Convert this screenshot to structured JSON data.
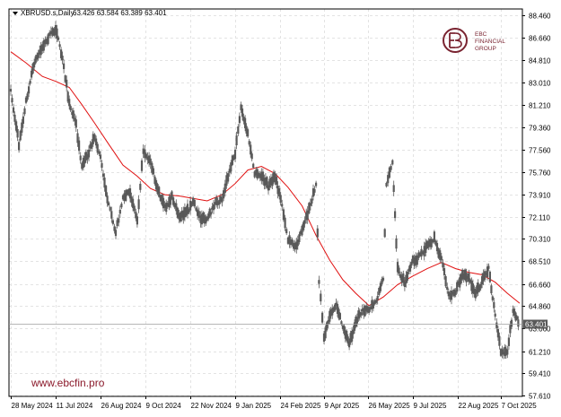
{
  "header": {
    "dropdown_icon": "triangle-down-icon",
    "symbol": "XBRUSD.s,Daily",
    "ohlc": "63.426 63.584 63.389 63.401"
  },
  "logo": {
    "icon": "ebc-monogram-icon",
    "line1": "EBC",
    "line2": "FINANCIAL",
    "line3": "GROUP",
    "color": "#7a2431"
  },
  "watermark": {
    "text": "www.ebcfin.pro",
    "color": "#8b1a2b"
  },
  "current_price": {
    "label": "63.401",
    "value": 63.401
  },
  "chart_data": {
    "type": "line",
    "title": "",
    "symbol": "XBRUSD.s",
    "timeframe": "Daily",
    "candle_color": "#595959",
    "ma_color": "#e01010",
    "grid": true,
    "y_ticks": [
      "88.460",
      "86.660",
      "84.810",
      "83.010",
      "81.210",
      "79.360",
      "77.560",
      "75.760",
      "73.910",
      "72.110",
      "70.310",
      "68.510",
      "66.660",
      "64.860",
      "63.060",
      "61.210",
      "59.410",
      "57.610"
    ],
    "ylim": [
      57.61,
      88.46
    ],
    "x_ticks": [
      "28 May 2024",
      "11 Jul 2024",
      "26 Aug 2024",
      "9 Oct 2024",
      "22 Nov 2024",
      "9 Jan 2025",
      "24 Feb 2025",
      "9 Apr 2025",
      "26 May 2025",
      "9 Jul 2025",
      "22 Aug 2025",
      "7 Oct 2025"
    ],
    "series": [
      {
        "name": "",
        "kind": "price",
        "x": [
          "2024-05-28",
          "2024-06-05",
          "2024-06-12",
          "2024-06-20",
          "2024-06-28",
          "2024-07-05",
          "2024-07-11",
          "2024-07-18",
          "2024-07-25",
          "2024-08-01",
          "2024-08-07",
          "2024-08-14",
          "2024-08-20",
          "2024-08-26",
          "2024-09-03",
          "2024-09-10",
          "2024-09-17",
          "2024-09-24",
          "2024-10-01",
          "2024-10-07",
          "2024-10-14",
          "2024-10-21",
          "2024-10-28",
          "2024-11-04",
          "2024-11-11",
          "2024-11-18",
          "2024-11-25",
          "2024-12-03",
          "2024-12-10",
          "2024-12-17",
          "2024-12-26",
          "2025-01-03",
          "2025-01-09",
          "2025-01-15",
          "2025-01-22",
          "2025-01-29",
          "2025-02-05",
          "2025-02-12",
          "2025-02-19",
          "2025-02-26",
          "2025-03-04",
          "2025-03-11",
          "2025-03-18",
          "2025-03-25",
          "2025-04-01",
          "2025-04-04",
          "2025-04-09",
          "2025-04-15",
          "2025-04-22",
          "2025-04-29",
          "2025-05-06",
          "2025-05-13",
          "2025-05-20",
          "2025-05-27",
          "2025-06-03",
          "2025-06-10",
          "2025-06-13",
          "2025-06-19",
          "2025-06-24",
          "2025-07-01",
          "2025-07-09",
          "2025-07-16",
          "2025-07-23",
          "2025-07-30",
          "2025-08-06",
          "2025-08-13",
          "2025-08-20",
          "2025-08-27",
          "2025-09-03",
          "2025-09-10",
          "2025-09-17",
          "2025-09-24",
          "2025-10-01",
          "2025-10-07",
          "2025-10-14",
          "2025-10-20",
          "2025-10-27"
        ],
        "y": [
          82.3,
          78.0,
          81.5,
          84.6,
          85.9,
          86.8,
          87.4,
          84.9,
          81.3,
          79.5,
          76.2,
          77.4,
          78.6,
          76.9,
          73.0,
          70.9,
          73.6,
          74.1,
          71.9,
          77.5,
          76.6,
          74.3,
          72.8,
          73.7,
          72.2,
          72.4,
          73.3,
          72.0,
          71.8,
          73.0,
          73.6,
          75.9,
          77.3,
          80.9,
          78.8,
          75.6,
          75.4,
          74.6,
          75.3,
          73.1,
          70.2,
          69.7,
          70.9,
          72.7,
          74.7,
          67.0,
          62.3,
          63.9,
          65.1,
          63.1,
          61.9,
          63.6,
          64.6,
          64.5,
          65.3,
          67.1,
          74.8,
          76.4,
          67.9,
          66.7,
          68.5,
          68.9,
          69.8,
          70.3,
          68.6,
          65.8,
          66.0,
          67.4,
          67.1,
          65.9,
          66.8,
          67.9,
          64.1,
          61.1,
          61.3,
          64.4,
          63.4
        ]
      },
      {
        "name": "",
        "kind": "moving-average",
        "x": [
          "2024-05-28",
          "2024-06-12",
          "2024-06-28",
          "2024-07-11",
          "2024-07-25",
          "2024-08-07",
          "2024-08-20",
          "2024-09-03",
          "2024-09-17",
          "2024-10-01",
          "2024-10-14",
          "2024-10-28",
          "2024-11-11",
          "2024-11-25",
          "2024-12-10",
          "2024-12-26",
          "2025-01-09",
          "2025-01-22",
          "2025-02-05",
          "2025-02-19",
          "2025-03-04",
          "2025-03-18",
          "2025-04-01",
          "2025-04-15",
          "2025-04-29",
          "2025-05-13",
          "2025-05-27",
          "2025-06-10",
          "2025-06-24",
          "2025-07-09",
          "2025-07-23",
          "2025-08-06",
          "2025-08-20",
          "2025-09-03",
          "2025-09-17",
          "2025-10-01",
          "2025-10-14",
          "2025-10-27"
        ],
        "y": [
          85.5,
          84.6,
          83.5,
          83.1,
          82.6,
          81.2,
          79.7,
          78.0,
          76.3,
          75.4,
          74.4,
          73.9,
          73.8,
          73.6,
          73.4,
          73.9,
          74.8,
          75.9,
          76.2,
          75.6,
          74.5,
          73.0,
          70.6,
          68.6,
          67.0,
          65.9,
          64.9,
          65.6,
          66.6,
          67.3,
          67.9,
          68.4,
          67.9,
          67.6,
          67.4,
          66.8,
          65.9,
          65.1
        ]
      }
    ]
  }
}
